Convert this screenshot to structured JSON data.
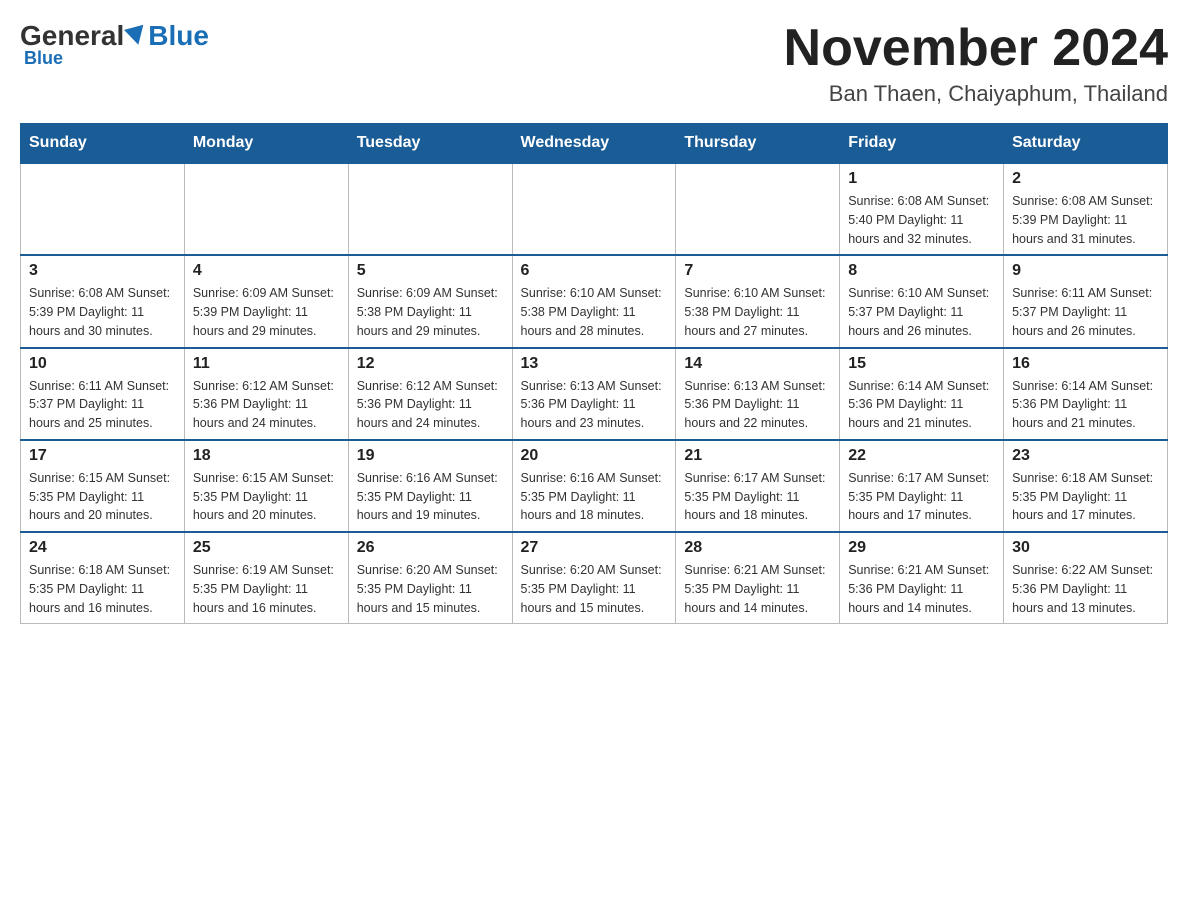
{
  "header": {
    "logo_general": "General",
    "logo_blue": "Blue",
    "month_title": "November 2024",
    "location": "Ban Thaen, Chaiyaphum, Thailand"
  },
  "days_of_week": [
    "Sunday",
    "Monday",
    "Tuesday",
    "Wednesday",
    "Thursday",
    "Friday",
    "Saturday"
  ],
  "weeks": [
    [
      {
        "day": "",
        "info": ""
      },
      {
        "day": "",
        "info": ""
      },
      {
        "day": "",
        "info": ""
      },
      {
        "day": "",
        "info": ""
      },
      {
        "day": "",
        "info": ""
      },
      {
        "day": "1",
        "info": "Sunrise: 6:08 AM\nSunset: 5:40 PM\nDaylight: 11 hours and 32 minutes."
      },
      {
        "day": "2",
        "info": "Sunrise: 6:08 AM\nSunset: 5:39 PM\nDaylight: 11 hours and 31 minutes."
      }
    ],
    [
      {
        "day": "3",
        "info": "Sunrise: 6:08 AM\nSunset: 5:39 PM\nDaylight: 11 hours and 30 minutes."
      },
      {
        "day": "4",
        "info": "Sunrise: 6:09 AM\nSunset: 5:39 PM\nDaylight: 11 hours and 29 minutes."
      },
      {
        "day": "5",
        "info": "Sunrise: 6:09 AM\nSunset: 5:38 PM\nDaylight: 11 hours and 29 minutes."
      },
      {
        "day": "6",
        "info": "Sunrise: 6:10 AM\nSunset: 5:38 PM\nDaylight: 11 hours and 28 minutes."
      },
      {
        "day": "7",
        "info": "Sunrise: 6:10 AM\nSunset: 5:38 PM\nDaylight: 11 hours and 27 minutes."
      },
      {
        "day": "8",
        "info": "Sunrise: 6:10 AM\nSunset: 5:37 PM\nDaylight: 11 hours and 26 minutes."
      },
      {
        "day": "9",
        "info": "Sunrise: 6:11 AM\nSunset: 5:37 PM\nDaylight: 11 hours and 26 minutes."
      }
    ],
    [
      {
        "day": "10",
        "info": "Sunrise: 6:11 AM\nSunset: 5:37 PM\nDaylight: 11 hours and 25 minutes."
      },
      {
        "day": "11",
        "info": "Sunrise: 6:12 AM\nSunset: 5:36 PM\nDaylight: 11 hours and 24 minutes."
      },
      {
        "day": "12",
        "info": "Sunrise: 6:12 AM\nSunset: 5:36 PM\nDaylight: 11 hours and 24 minutes."
      },
      {
        "day": "13",
        "info": "Sunrise: 6:13 AM\nSunset: 5:36 PM\nDaylight: 11 hours and 23 minutes."
      },
      {
        "day": "14",
        "info": "Sunrise: 6:13 AM\nSunset: 5:36 PM\nDaylight: 11 hours and 22 minutes."
      },
      {
        "day": "15",
        "info": "Sunrise: 6:14 AM\nSunset: 5:36 PM\nDaylight: 11 hours and 21 minutes."
      },
      {
        "day": "16",
        "info": "Sunrise: 6:14 AM\nSunset: 5:36 PM\nDaylight: 11 hours and 21 minutes."
      }
    ],
    [
      {
        "day": "17",
        "info": "Sunrise: 6:15 AM\nSunset: 5:35 PM\nDaylight: 11 hours and 20 minutes."
      },
      {
        "day": "18",
        "info": "Sunrise: 6:15 AM\nSunset: 5:35 PM\nDaylight: 11 hours and 20 minutes."
      },
      {
        "day": "19",
        "info": "Sunrise: 6:16 AM\nSunset: 5:35 PM\nDaylight: 11 hours and 19 minutes."
      },
      {
        "day": "20",
        "info": "Sunrise: 6:16 AM\nSunset: 5:35 PM\nDaylight: 11 hours and 18 minutes."
      },
      {
        "day": "21",
        "info": "Sunrise: 6:17 AM\nSunset: 5:35 PM\nDaylight: 11 hours and 18 minutes."
      },
      {
        "day": "22",
        "info": "Sunrise: 6:17 AM\nSunset: 5:35 PM\nDaylight: 11 hours and 17 minutes."
      },
      {
        "day": "23",
        "info": "Sunrise: 6:18 AM\nSunset: 5:35 PM\nDaylight: 11 hours and 17 minutes."
      }
    ],
    [
      {
        "day": "24",
        "info": "Sunrise: 6:18 AM\nSunset: 5:35 PM\nDaylight: 11 hours and 16 minutes."
      },
      {
        "day": "25",
        "info": "Sunrise: 6:19 AM\nSunset: 5:35 PM\nDaylight: 11 hours and 16 minutes."
      },
      {
        "day": "26",
        "info": "Sunrise: 6:20 AM\nSunset: 5:35 PM\nDaylight: 11 hours and 15 minutes."
      },
      {
        "day": "27",
        "info": "Sunrise: 6:20 AM\nSunset: 5:35 PM\nDaylight: 11 hours and 15 minutes."
      },
      {
        "day": "28",
        "info": "Sunrise: 6:21 AM\nSunset: 5:35 PM\nDaylight: 11 hours and 14 minutes."
      },
      {
        "day": "29",
        "info": "Sunrise: 6:21 AM\nSunset: 5:36 PM\nDaylight: 11 hours and 14 minutes."
      },
      {
        "day": "30",
        "info": "Sunrise: 6:22 AM\nSunset: 5:36 PM\nDaylight: 11 hours and 13 minutes."
      }
    ]
  ]
}
